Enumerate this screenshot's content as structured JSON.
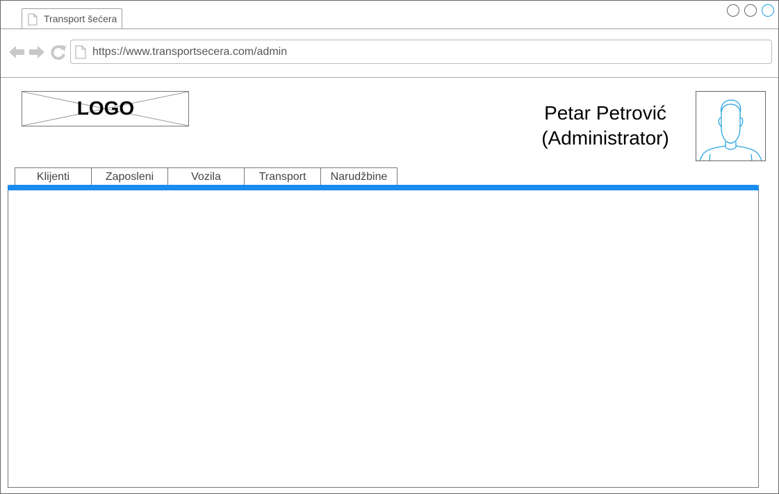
{
  "browser": {
    "tab_title": "Transport šećera",
    "url": "https://www.transportsecera.com/admin"
  },
  "header": {
    "logo_text": "LOGO",
    "user_name": "Petar Petrović",
    "user_role": "(Administrator)"
  },
  "nav": {
    "tabs": [
      {
        "label": "Klijenti"
      },
      {
        "label": "Zaposleni"
      },
      {
        "label": "Vozila"
      },
      {
        "label": "Transport"
      },
      {
        "label": "Narudžbine"
      }
    ]
  },
  "colors": {
    "accent": "#1a8cf0",
    "avatar_stroke": "#1a9ee0",
    "icon_gray": "#c8c8c8"
  }
}
